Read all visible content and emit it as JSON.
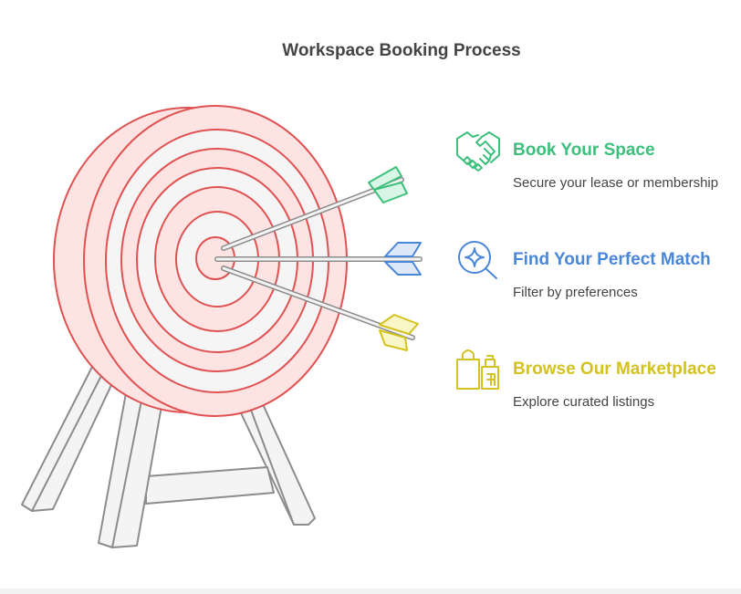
{
  "title": "Workspace Booking Process",
  "colors": {
    "green": "#3cc07c",
    "blue": "#4a87d8",
    "yellow": "#d4c21e",
    "target_ring": "#e05252",
    "target_fill": "#fde4e3",
    "target_light": "#f5f5f5",
    "stand": "#8c8c8c"
  },
  "steps": [
    {
      "title": "Book Your Space",
      "description": "Secure your lease or membership",
      "color": "#3cc07c",
      "icon": "handshake-icon"
    },
    {
      "title": "Find Your Perfect Match",
      "description": "Filter by preferences",
      "color": "#4a87d8",
      "icon": "search-sparkle-icon"
    },
    {
      "title": "Browse Our Marketplace",
      "description": "Explore curated listings",
      "color": "#d4c21e",
      "icon": "shopping-bags-icon"
    }
  ]
}
